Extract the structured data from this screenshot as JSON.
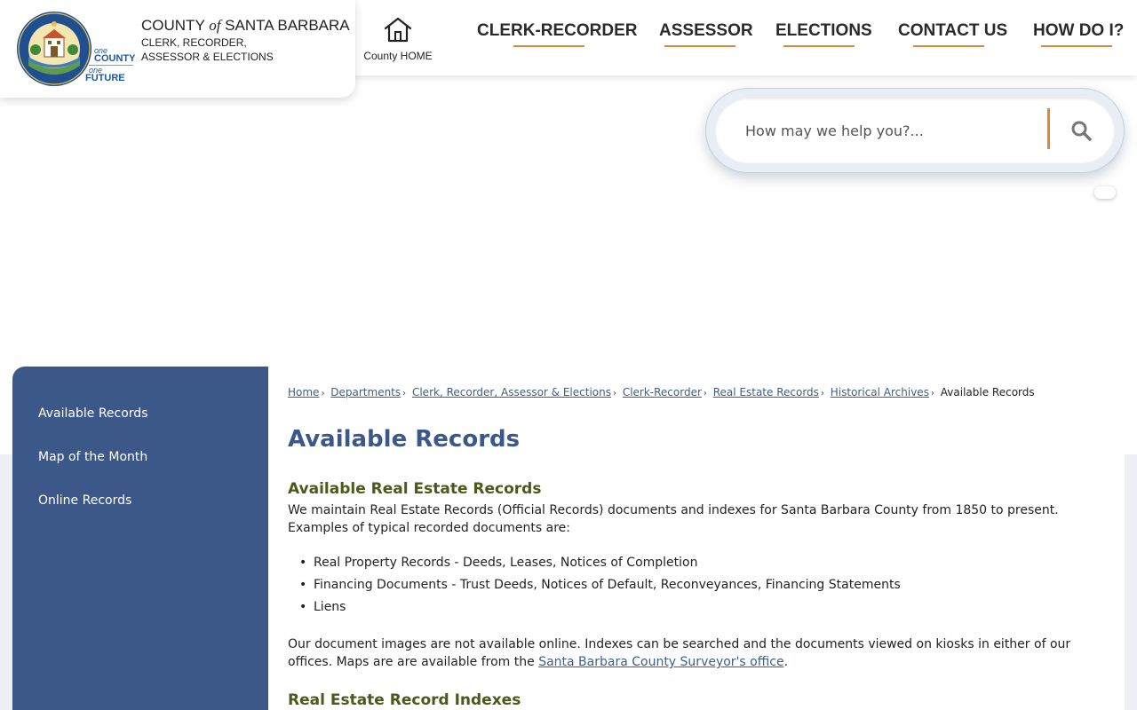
{
  "header": {
    "org_title_pre": "COUNTY ",
    "org_title_of": "of",
    "org_title_post": " SANTA BARBARA",
    "org_sub_line1": "CLERK, RECORDER,",
    "org_sub_line2": "ASSESSOR & ELECTIONS",
    "seal_text": "COUNTY OF SANTA BARBARA CALIFORNIA",
    "tagline": {
      "one_a": "one",
      "county": "COUNTY",
      "one_b": "one",
      "future": "FUTURE"
    },
    "home_label": "County HOME",
    "home_icon": "house-icon"
  },
  "nav": {
    "items": [
      {
        "label": "CLERK-RECORDER"
      },
      {
        "label": "ASSESSOR"
      },
      {
        "label": "ELECTIONS"
      },
      {
        "label": "CONTACT US"
      },
      {
        "label": "HOW DO I?"
      }
    ]
  },
  "search": {
    "placeholder": "How may we help you?...",
    "value": "",
    "icon": "search-icon"
  },
  "sidebar": {
    "items": [
      {
        "label": "Available Records"
      },
      {
        "label": "Map of the Month"
      },
      {
        "label": "Online Records"
      }
    ]
  },
  "breadcrumb": {
    "links": [
      "Home",
      " Departments",
      " Clerk, Recorder, Assessor & Elections",
      " Clerk-Recorder",
      " Real Estate Records",
      " Historical Archives"
    ],
    "current": "Available Records"
  },
  "main": {
    "page_title": "Available Records",
    "section1_heading": "Available Real Estate Records",
    "intro": "We maintain Real Estate Records (Official Records) documents and indexes for Santa Barbara County from 1850 to present. Examples of typical recorded documents are:",
    "bullets": [
      "Real Property Records - Deeds, Leases, Notices of Completion",
      "Financing Documents - Trust Deeds, Notices of Default, Reconveyances, Financing Statements",
      "Liens"
    ],
    "para2_text": "Our document images are not available online. Indexes can be searched and the documents viewed on kiosks in either of our offices. Maps are are available from the ",
    "para2_link": "Santa Barbara County Surveyor's office",
    "para2_end": ".",
    "section2_heading": "Real Estate Record Indexes"
  },
  "colors": {
    "sidebar_bg": "#3c5888",
    "title_blue": "#3c5888",
    "heading_olive": "#4a5a1a",
    "accent_orange": "#d98a3a",
    "link_blue": "#3c5e8c"
  }
}
